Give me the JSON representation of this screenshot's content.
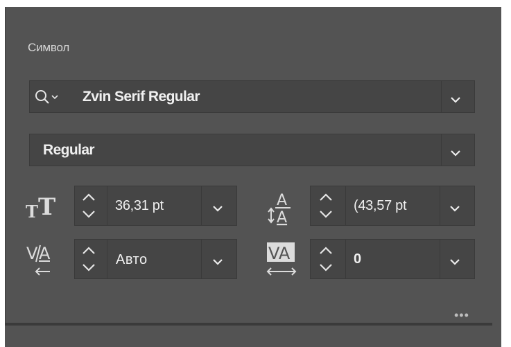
{
  "panel": {
    "title": "Символ"
  },
  "font_family": {
    "value": "Zvin Serif Regular",
    "search_icon": "search-icon",
    "dropdown_icon": "chevron-down-icon"
  },
  "font_style": {
    "value": "Regular",
    "dropdown_icon": "chevron-down-icon"
  },
  "font_size": {
    "icon": "font-size-icon",
    "value": "36,31 pt"
  },
  "leading": {
    "icon": "leading-icon",
    "value": "(43,57 pt"
  },
  "kerning": {
    "icon": "kerning-icon",
    "value": "Авто"
  },
  "tracking": {
    "icon": "tracking-icon",
    "value": "0"
  },
  "more_menu": {
    "label": "•••"
  },
  "colors": {
    "panel_bg": "#535353",
    "field_bg": "#454545",
    "text": "#f0f0f0"
  }
}
